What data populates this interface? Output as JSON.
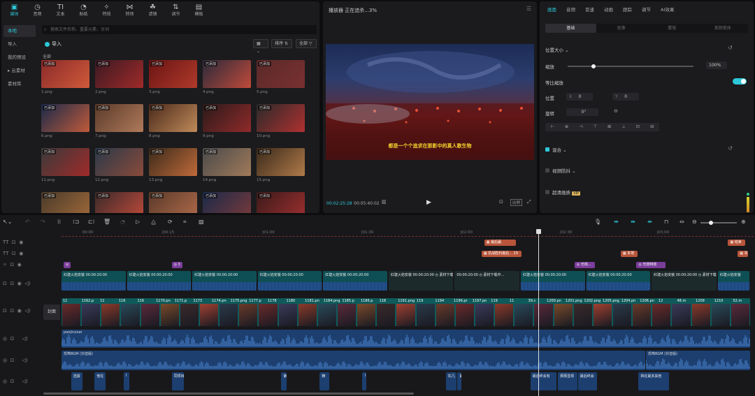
{
  "media": {
    "tools": [
      {
        "icon": "media-icon",
        "glyph": "▣",
        "label": "媒体"
      },
      {
        "icon": "audio-icon",
        "glyph": "◷",
        "label": "音频"
      },
      {
        "icon": "text-icon",
        "glyph": "TI",
        "label": "文本"
      },
      {
        "icon": "sticker-icon",
        "glyph": "◔",
        "label": "贴纸"
      },
      {
        "icon": "effects-icon",
        "glyph": "✧",
        "label": "特效"
      },
      {
        "icon": "transition-icon",
        "glyph": "⋈",
        "label": "转场"
      },
      {
        "icon": "filter-icon",
        "glyph": "☘",
        "label": "滤镜"
      },
      {
        "icon": "adjust-icon",
        "glyph": "⇅",
        "label": "调节"
      },
      {
        "icon": "template-icon",
        "glyph": "▤",
        "label": "模板"
      }
    ],
    "side": [
      "本地",
      "导入",
      "我的预设",
      "▸ 云素材",
      "素材库"
    ],
    "search_placeholder": "搜索文件名称、重要元素、台词",
    "import_label": "导入",
    "view_btn": "▦ ⌄",
    "sort_btn": "排序 ⇅",
    "filter_btn": "全部 ▽",
    "all_label": "全部",
    "added_tag": "已添加",
    "files": [
      {
        "name": "1.png",
        "c1": "#8a2a2a",
        "c2": "#d05a3a"
      },
      {
        "name": "2.png",
        "c1": "#3a1a22",
        "c2": "#a02a2a"
      },
      {
        "name": "3.png",
        "c1": "#6a1414",
        "c2": "#b03a2a"
      },
      {
        "name": "4.png",
        "c1": "#2a2a3a",
        "c2": "#c04a3a"
      },
      {
        "name": "5.png",
        "c1": "#5a2a2a",
        "c2": "#7a3030"
      },
      {
        "name": "6.png",
        "c1": "#1a2a4a",
        "c2": "#c05a3a"
      },
      {
        "name": "7.png",
        "c1": "#5a3a2a",
        "c2": "#b07a5a"
      },
      {
        "name": "8.png",
        "c1": "#4a2a1a",
        "c2": "#c08a5a"
      },
      {
        "name": "9.png",
        "c1": "#2a1a1a",
        "c2": "#902a2a"
      },
      {
        "name": "10.png",
        "c1": "#2a2a2a",
        "c2": "#b03030"
      },
      {
        "name": "11.png",
        "c1": "#3a3a3a",
        "c2": "#a02a2a"
      },
      {
        "name": "12.png",
        "c1": "#2a3a4a",
        "c2": "#8a4a3a"
      },
      {
        "name": "13.png",
        "c1": "#3a2a1a",
        "c2": "#c06a3a"
      },
      {
        "name": "14.png",
        "c1": "#4a4a4a",
        "c2": "#a07a5a"
      },
      {
        "name": "15.png",
        "c1": "#3a2a1a",
        "c2": "#b07a4a"
      },
      {
        "name": "",
        "c1": "#4a3a2a",
        "c2": "#a06a3a"
      },
      {
        "name": "",
        "c1": "#3a2a2a",
        "c2": "#c04a3a"
      },
      {
        "name": "",
        "c1": "#5a3a2a",
        "c2": "#b06a4a"
      },
      {
        "name": "",
        "c1": "#1a2a4a",
        "c2": "#7a3a3a"
      },
      {
        "name": "",
        "c1": "#3a1a1a",
        "c2": "#a03030"
      }
    ]
  },
  "player": {
    "title": "播放器 正在追杀...3%",
    "subtitle": "都是一个个追求在那影中的真人歌生物",
    "time_current": "00:02:25:28",
    "time_total": "00:05:40:02",
    "ratio": "比例"
  },
  "props": {
    "tabs": [
      "画面",
      "音频",
      "变速",
      "动画",
      "跟踪",
      "调节",
      "AI效果"
    ],
    "subtabs": [
      "基础",
      "抠像",
      "蒙版",
      "美颜美体"
    ],
    "position_size": "位置大小 ⌄",
    "scale": "缩放",
    "scale_value": "100%",
    "uniform": "等比缩放",
    "position": "位置",
    "x_label": "X",
    "x_value": "0",
    "y_label": "Y",
    "y_value": "0",
    "rotate": "旋转",
    "rotate_value": "0°",
    "blend": "混合 ⌄",
    "stabilize": "视频防抖 ⌄",
    "hd": "超清画质",
    "hd_badge": "VIP",
    "align_icons": [
      "⊢",
      "⊕",
      "⊣",
      "⊤",
      "⊞",
      "⊥",
      "⊡",
      "⊟"
    ]
  },
  "timeline": {
    "ruler": [
      {
        "t": "00:00",
        "pct": 0.03
      },
      {
        "t": "|00:15",
        "pct": 0.145
      },
      {
        "t": "|01:00",
        "pct": 0.29
      },
      {
        "t": "|01:30",
        "pct": 0.433
      },
      {
        "t": "|02:00",
        "pct": 0.576
      },
      {
        "t": "|02:30",
        "pct": 0.72
      },
      {
        "t": "|03:00",
        "pct": 0.86
      }
    ],
    "text_clips_1": [
      {
        "label": "▦ 最后赢",
        "left": 0.614,
        "width": 0.046
      },
      {
        "label": "▦ 结束",
        "left": 0.968,
        "width": 0.025
      }
    ],
    "text_clips_2": [
      {
        "label": "▦ 抗战胜利最后... 29",
        "left": 0.61,
        "width": 0.058
      },
      {
        "label": "▦ 本地",
        "left": 0.812,
        "width": 0.025
      },
      {
        "label": "▦ 本",
        "left": 0.982,
        "width": 0.015
      }
    ],
    "sticker_clips": [
      {
        "label": "◎",
        "left": 0.003,
        "width": 0.01
      },
      {
        "label": "◎ 3",
        "left": 0.16,
        "width": 0.016
      },
      {
        "label": "◎ 光线...",
        "left": 0.745,
        "width": 0.03
      },
      {
        "label": "◎ 光效特效",
        "left": 0.835,
        "width": 0.042
      }
    ],
    "video_clips": [
      {
        "label": "红建火焰安装 00:00:20:00",
        "left": 0.0,
        "width": 0.094,
        "c": "#0e4f55"
      },
      {
        "label": "红建火焰安装 00:00:20:00",
        "left": 0.095,
        "width": 0.094,
        "c": "#0e4f55"
      },
      {
        "label": "红建火焰安装 00:00:20:00",
        "left": 0.19,
        "width": 0.094,
        "c": "#0e4f55"
      },
      {
        "label": "红建火焰安装 00:00:20:00",
        "left": 0.285,
        "width": 0.094,
        "c": "#0e4f55"
      },
      {
        "label": "红建火焰安装 00:00:20:00",
        "left": 0.38,
        "width": 0.094,
        "c": "#0e4f55"
      },
      {
        "label": "红建火焰安装 00:00:20:00 ◷ 素材下载中...",
        "left": 0.475,
        "width": 0.095,
        "c": "#1c2a2c"
      },
      {
        "label": "00:00:20:00 ◷ 素材下载中...",
        "left": 0.571,
        "width": 0.095,
        "c": "#1c2a2c"
      },
      {
        "label": "红建火焰安装 00:00:20:00",
        "left": 0.667,
        "width": 0.094,
        "c": "#0e4f55"
      },
      {
        "label": "红建火焰安装 00:00:20:00",
        "left": 0.762,
        "width": 0.094,
        "c": "#0e4f55"
      },
      {
        "label": "红建火焰安装 00:00:20:00 ◷ 素材下载中...",
        "left": 0.857,
        "width": 0.095,
        "c": "#1c2a2c"
      },
      {
        "label": "红建火焰安装",
        "left": 0.953,
        "width": 0.047,
        "c": "#0e4f55"
      }
    ],
    "main_labels": [
      "11",
      "1162.p",
      "11",
      "116",
      "116",
      "1170.pn",
      "1171.p",
      "1173",
      "1174.pn",
      "1175.png",
      "1177.p",
      "1178",
      "1180",
      "1181.pn",
      "1184.png",
      "1185.p",
      "1186.p",
      "118",
      "1191.png",
      "119",
      "1194",
      "1196.pr",
      "1197.pn",
      "119",
      "11",
      "39.c",
      "1200.pn",
      "1201.png",
      "1202.png",
      "1205.png",
      "1204.pn",
      "1206.pn",
      "12",
      "48.m",
      "1209",
      "1210",
      "52.m"
    ],
    "cover": "封面",
    "thumb_colors": [
      "#6a2a2a",
      "#3a3a5a",
      "#8a3a2a",
      "#2a4a5a",
      "#5a2a3a",
      "#7a4a2a",
      "#3a2a2a",
      "#a04030",
      "#2a3a4a",
      "#6a3a2a"
    ],
    "audio1_label": "paojiruixai",
    "audio2_label": "恐怖BGM (抖音版)",
    "audio2b_label": "恐怖BGM (抖音版)",
    "voice_clips": [
      {
        "label": "选拔",
        "left": 0.014,
        "width": 0.016
      },
      {
        "label": "他在",
        "left": 0.048,
        "width": 0.016
      },
      {
        "label": "I",
        "left": 0.09,
        "width": 0.008
      },
      {
        "label": "同项目",
        "left": 0.16,
        "width": 0.018
      },
      {
        "label": "第",
        "left": 0.319,
        "width": 0.008
      },
      {
        "label": "精",
        "left": 0.375,
        "width": 0.014
      },
      {
        "label": "I",
        "left": 0.437,
        "width": 0.006
      },
      {
        "label": "先几",
        "left": 0.558,
        "width": 0.016
      },
      {
        "label": "最终",
        "left": 0.575,
        "width": 0.006
      },
      {
        "label": "最后终会有",
        "left": 0.681,
        "width": 0.038
      },
      {
        "label": "那那显现",
        "left": 0.721,
        "width": 0.028
      },
      {
        "label": "最后终会",
        "left": 0.75,
        "width": 0.028
      },
      {
        "label": "挡在最多其他",
        "left": 0.838,
        "width": 0.044
      }
    ]
  }
}
